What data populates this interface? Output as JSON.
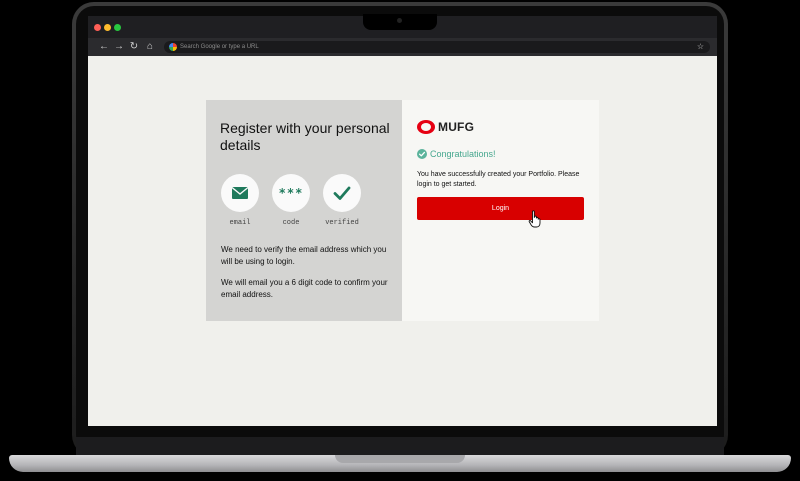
{
  "browser": {
    "omnibox_placeholder": "Search Google or type a URL",
    "nav": [
      "←",
      "→",
      "↻",
      "⌂"
    ],
    "icons": [
      "back-arrow-icon",
      "forward-arrow-icon",
      "reload-icon",
      "home-icon",
      "google-icon",
      "star-icon"
    ]
  },
  "register": {
    "title": "Register with your personal details",
    "steps": [
      {
        "label": "email",
        "icon": "envelope-icon"
      },
      {
        "label": "code",
        "icon": "asterisks-icon",
        "glyph": "***"
      },
      {
        "label": "verified",
        "icon": "checkmark-icon"
      }
    ],
    "paragraph1": "We need to verify the email address which you will be using to login.",
    "paragraph2": "We will email you a 6 digit code to confirm your email address."
  },
  "success": {
    "brand": "MUFG",
    "heading": "Congratulations!",
    "message": "You have successfully created your Portfolio. Please login to get started.",
    "login_label": "Login"
  },
  "colors": {
    "accent_red": "#d80000",
    "brand_red": "#e60012",
    "success_green": "#46a78e",
    "step_icon_green": "#1f7a5c"
  }
}
